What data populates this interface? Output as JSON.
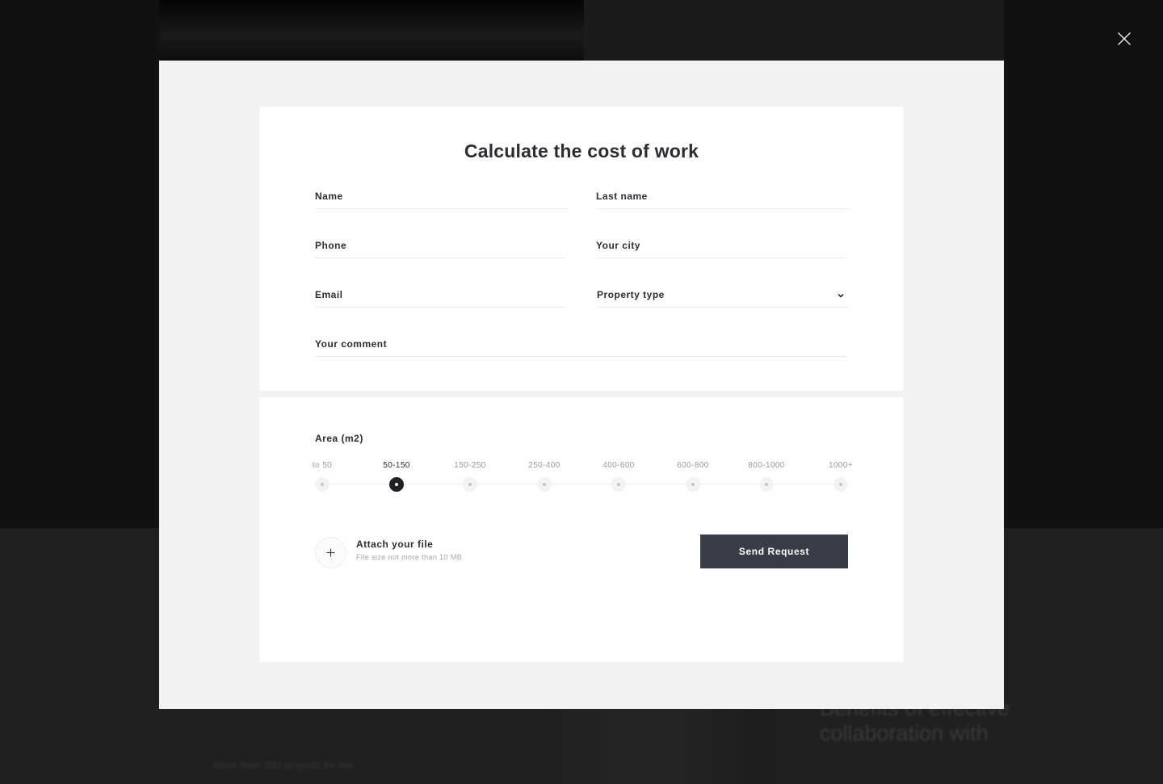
{
  "background": {
    "heading": "Benefits of effective collaboration with",
    "small_text": "More than 200 projects for the"
  },
  "modal": {
    "title": "Calculate the cost of work",
    "fields": {
      "name": {
        "label": "Name",
        "value": ""
      },
      "last_name": {
        "label": "Last name",
        "value": ""
      },
      "phone": {
        "label": "Phone",
        "value": ""
      },
      "city": {
        "label": "Your city",
        "value": ""
      },
      "email": {
        "label": "Email",
        "value": ""
      },
      "property_type": {
        "label": "Property type",
        "selected": ""
      },
      "comment": {
        "label": "Your comment",
        "value": ""
      }
    },
    "area": {
      "label": "Area (m2)",
      "options": [
        "to 50",
        "50-150",
        "150-250",
        "250-400",
        "400-600",
        "600-800",
        "800-1000",
        "1000+"
      ],
      "selected_index": 1
    },
    "attach": {
      "title": "Attach your file",
      "hint": "File size not more than 10 MB"
    },
    "submit_label": "Send Request"
  },
  "icons": {
    "close": "close-icon",
    "chevron": "chevron-down-icon",
    "plus": "plus-icon"
  },
  "colors": {
    "overlay": "#111112",
    "modal_bg": "#f2f2f2",
    "card_bg": "#ffffff",
    "text": "#2c2d33",
    "button": "#3a3d47",
    "active_dot": "#1f2025"
  }
}
